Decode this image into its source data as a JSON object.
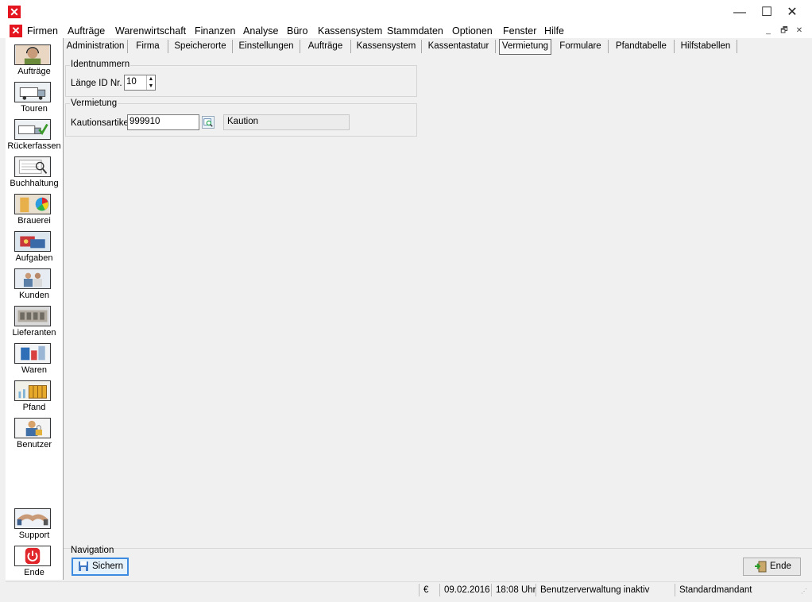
{
  "window": {
    "minimize": "—",
    "maximize": "☐",
    "close": "✕"
  },
  "menu": [
    "Firmen",
    "Aufträge",
    "Warenwirtschaft",
    "Finanzen",
    "Analyse",
    "Büro",
    "Kassensystem",
    "Stammdaten",
    "Optionen",
    "Fenster",
    "Hilfe"
  ],
  "mdi": {
    "minimize": "_",
    "restore": "🗗",
    "close": "✕"
  },
  "sidebar": {
    "top": [
      {
        "label": "Aufträge",
        "icon": "headset-operator-icon"
      },
      {
        "label": "Touren",
        "icon": "truck-icon"
      },
      {
        "label": "Rückerfassen",
        "icon": "truck-check-icon"
      },
      {
        "label": "Buchhaltung",
        "icon": "ledger-magnifier-icon"
      },
      {
        "label": "Brauerei",
        "icon": "beer-color-icon"
      },
      {
        "label": "Aufgaben",
        "icon": "tasks-icon"
      },
      {
        "label": "Kunden",
        "icon": "customers-icon"
      },
      {
        "label": "Lieferanten",
        "icon": "suppliers-icon"
      },
      {
        "label": "Waren",
        "icon": "goods-icon"
      },
      {
        "label": "Pfand",
        "icon": "deposit-crate-icon"
      },
      {
        "label": "Benutzer",
        "icon": "user-lock-icon"
      }
    ],
    "bottom": [
      {
        "label": "Support",
        "icon": "handshake-icon"
      },
      {
        "label": "Ende",
        "icon": "power-icon"
      }
    ]
  },
  "tabs": [
    "Administration",
    "Firma",
    "Speicherorte",
    "Einstellungen",
    "Aufträge",
    "Kassensystem",
    "Kassentastatur",
    "Vermietung",
    "Formulare",
    "Pfandtabelle",
    "Hilfstabellen"
  ],
  "active_tab": "Vermietung",
  "ident": {
    "title": "Identnummern",
    "label": "Länge ID Nr.",
    "value": "10"
  },
  "rental": {
    "title": "Vermietung",
    "label": "Kautionsartikel",
    "value": "999910",
    "description": "Kaution"
  },
  "navigation": {
    "title": "Navigation",
    "save": "Sichern",
    "end": "Ende"
  },
  "status": {
    "currency": "€",
    "date": "09.02.2016",
    "time": "18:08 Uhr",
    "user_admin": "Benutzerverwaltung inaktiv",
    "tenant": "Standardmandant"
  },
  "colors": {
    "accent": "#3c8be0",
    "app_red": "#e4151f"
  }
}
